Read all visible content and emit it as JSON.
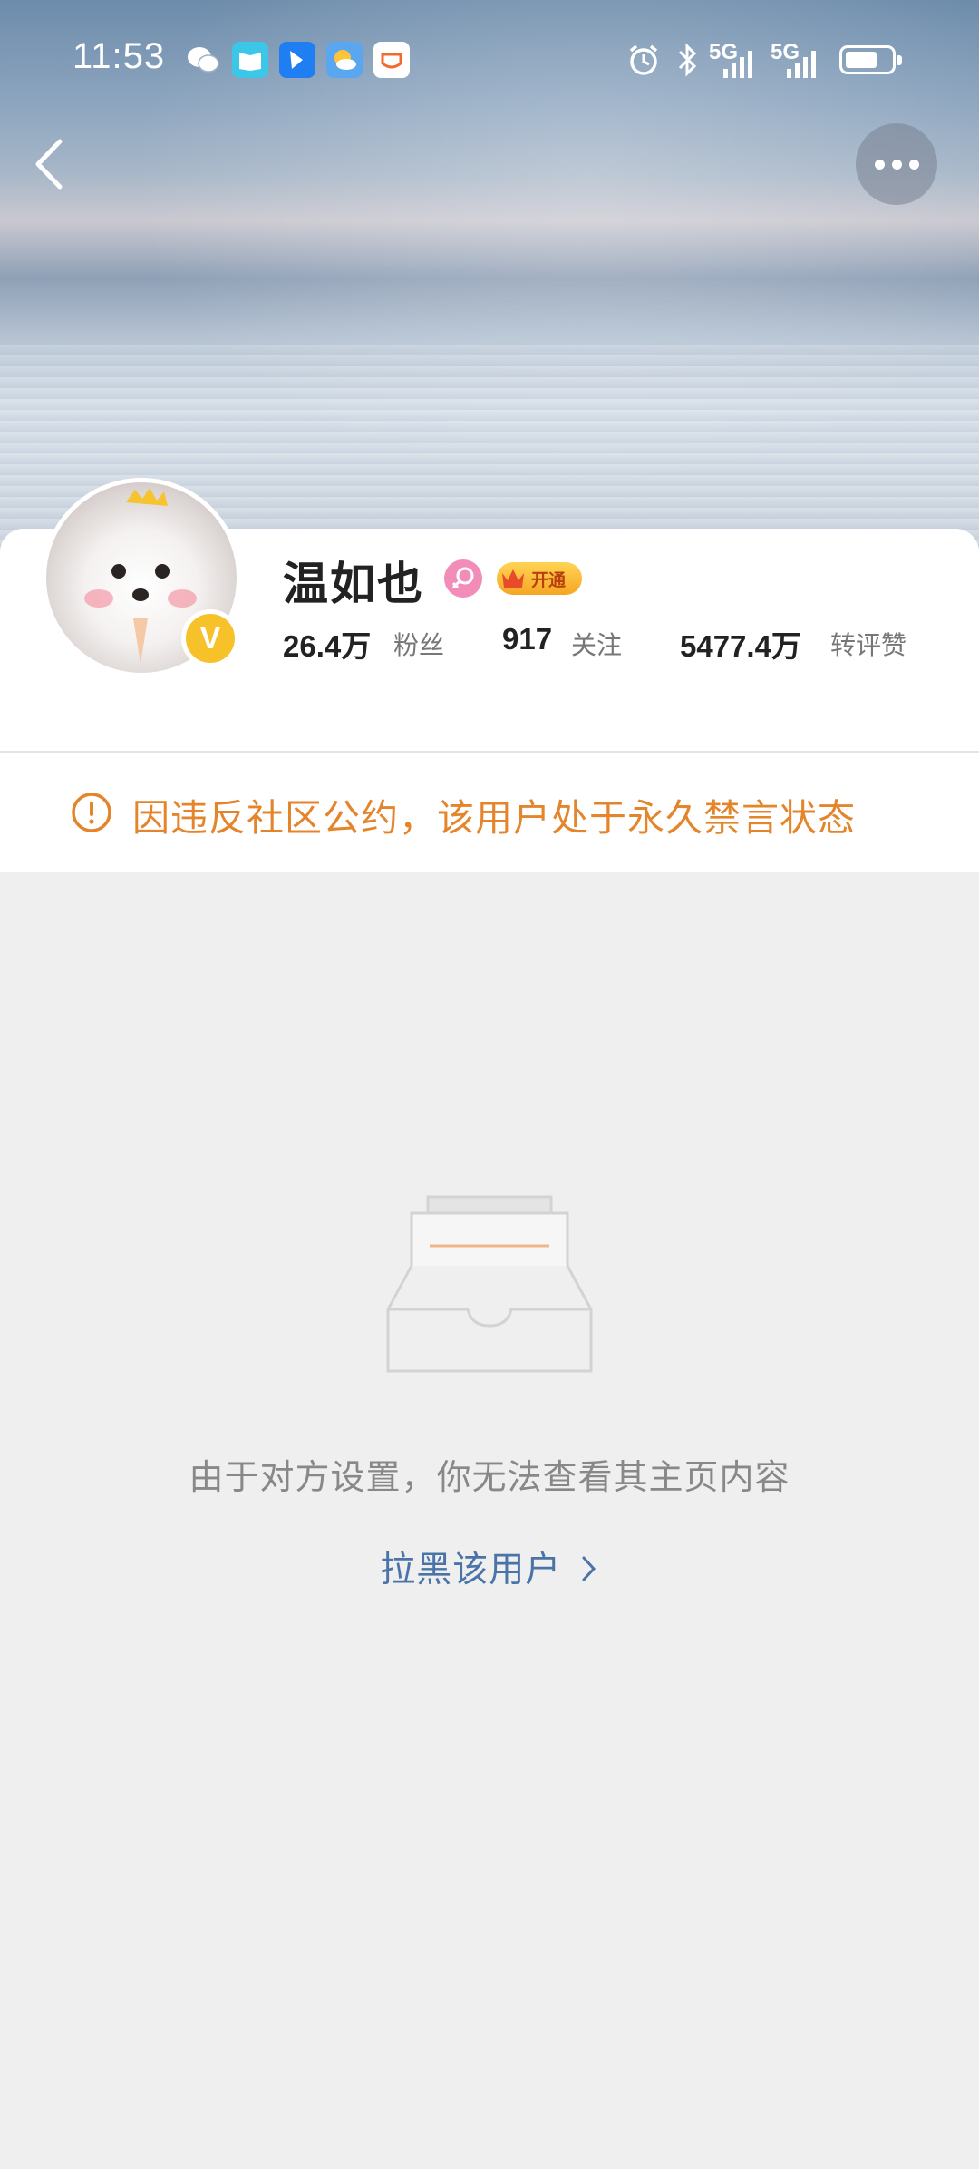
{
  "status_bar": {
    "time": "11:53",
    "signal_1": "5G",
    "signal_2": "5G"
  },
  "nav": {
    "back_icon": "chevron-left-icon",
    "more_icon": "more-horizontal-icon"
  },
  "profile": {
    "name": "温如也",
    "gender": "female",
    "vip_label": "开通",
    "verified": "V",
    "stats": [
      {
        "value": "26.4万",
        "label": "粉丝"
      },
      {
        "value": "917",
        "label": "关注"
      },
      {
        "value": "5477.4万",
        "label": "转评赞"
      }
    ]
  },
  "ban_notice": {
    "text": "因违反社区公约，该用户处于永久禁言状态",
    "color": "#e5852b"
  },
  "empty_state": {
    "message": "由于对方设置，你无法查看其主页内容",
    "action": "拉黑该用户",
    "action_color": "#4a74a8"
  }
}
